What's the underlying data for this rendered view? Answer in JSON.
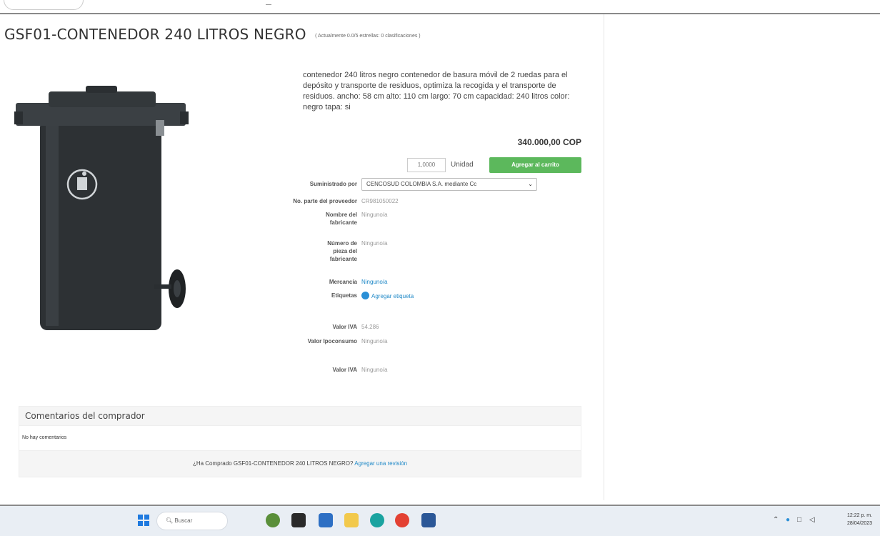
{
  "product": {
    "title": "GSF01-CONTENEDOR 240 LITROS NEGRO",
    "rating": "( Actualmente 0.0/5 estrellas: 0 clasificaciones )",
    "description": "contenedor 240 litros negro contenedor de basura móvil de 2 ruedas para el depósito y transporte de residuos, optimiza la recogida y el transporte de residuos. ancho: 58 cm alto: 110 cm largo: 70 cm capacidad: 240 litros color: negro tapa: si",
    "price": "340.000,00 COP"
  },
  "purchase": {
    "quantity": "1,0000",
    "unit": "Unidad",
    "add_to_cart": "Agregar al carrito"
  },
  "fields": {
    "supplier_label": "Suministrado por",
    "supplier_value": "CENCOSUD COLOMBIA S.A. mediante Cc",
    "part_no_label": "No. parte del proveedor",
    "part_no_value": "CR981050022",
    "mfr_name_label": "Nombre del fabricante",
    "mfr_name_value": "Ninguno/a",
    "mfr_part_label": "Número de pieza del fabricante",
    "mfr_part_value": "Ninguno/a",
    "commodity_label": "Mercancía",
    "commodity_value": "Ninguno/a",
    "tags_label": "Etiquetas",
    "tags_value": "Agregar etiqueta",
    "iva_label": "Valor IVA",
    "iva_value": "54.286",
    "ipoconsumo_label": "Valor Ipoconsumo",
    "ipoconsumo_value": "Ninguno/a",
    "iva2_label": "Valor IVA",
    "iva2_value": "Ninguno/a"
  },
  "comments": {
    "heading": "Comentarios del comprador",
    "empty": "No hay comentarios",
    "prompt": "¿Ha Comprado GSF01-CONTENEDOR 240 LITROS NEGRO?",
    "review_link": "Agregar una revisión"
  },
  "taskbar": {
    "search_placeholder": "Buscar",
    "time": "12:22 p. m.",
    "date": "28/04/2023"
  },
  "colors": {
    "accent_green": "#5cb85c",
    "link_blue": "#1e88c7"
  }
}
